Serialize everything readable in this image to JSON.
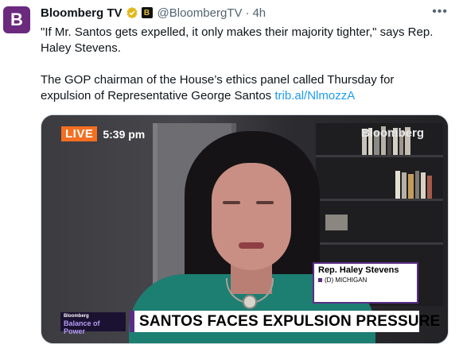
{
  "author": {
    "avatar_letter": "B",
    "name": "Bloomberg TV",
    "handle": "@BloombergTV",
    "separator": "·",
    "time": "4h",
    "affiliate_badge": "B"
  },
  "tweet": {
    "line1": "\"If Mr. Santos gets expelled, it only makes their majority tighter,\" says Rep. Haley Stevens.",
    "line2": "The GOP chairman of the House’s ethics panel called Thursday for expulsion of Representative George Santos ",
    "link": "trib.al/NlmozzA"
  },
  "video": {
    "live_label": "LIVE",
    "clock": "5:39 pm",
    "brand": "Bloomberg",
    "namecard_name": "Rep. Haley Stevens",
    "namecard_party": "(D) MICHIGAN",
    "show_line1": "Bloomberg",
    "show_line2": "Balance of Power",
    "banner": "SANTOS FACES EXPULSION PRESSURE"
  },
  "icons": {
    "more": "more-icon",
    "verified": "verified-badge-icon",
    "affiliate": "affiliate-badge-icon"
  },
  "colors": {
    "avatar_bg": "#6b2a7e",
    "link": "#1d9bf0",
    "verified_gold": "#e2b719",
    "live_orange": "#f36f21",
    "bloomberg_purple": "#5b2d86"
  }
}
